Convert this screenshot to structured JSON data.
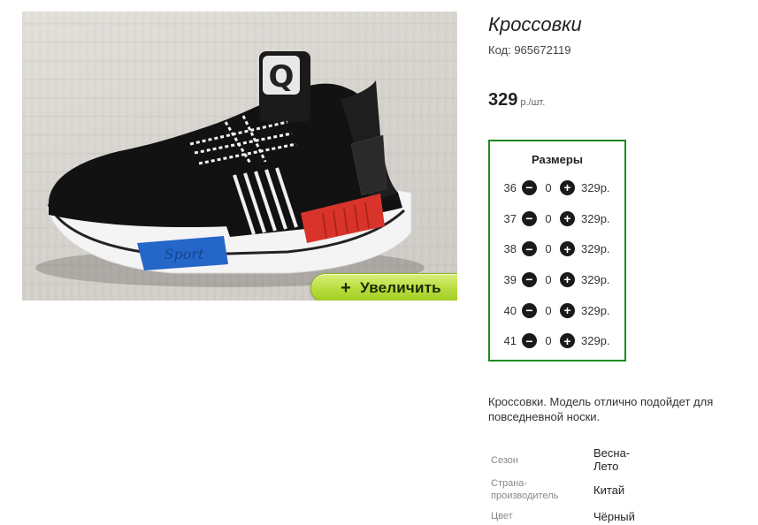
{
  "product": {
    "title": "Кроссовки",
    "code_label": "Код: 965672119",
    "price": "329",
    "price_unit": "р./шт.",
    "zoom_button": {
      "icon": "+",
      "label": "Увеличить"
    }
  },
  "sizes": {
    "title": "Размеры",
    "rows": [
      {
        "size": "36",
        "qty": "0",
        "price": "329р."
      },
      {
        "size": "37",
        "qty": "0",
        "price": "329р."
      },
      {
        "size": "38",
        "qty": "0",
        "price": "329р."
      },
      {
        "size": "39",
        "qty": "0",
        "price": "329р."
      },
      {
        "size": "40",
        "qty": "0",
        "price": "329р."
      },
      {
        "size": "41",
        "qty": "0",
        "price": "329р."
      }
    ]
  },
  "description": "Кроссовки. Модель отлично подойдет для повседневной носки.",
  "properties": [
    {
      "label": "Сезон",
      "value": "Весна-Лето"
    },
    {
      "label": "Страна-производитель",
      "value": "Китай"
    },
    {
      "label": "Цвет",
      "value": "Чёрный"
    }
  ],
  "colors": {
    "border": "#1f8a1f",
    "zoom_button": "#b7dc3c"
  }
}
